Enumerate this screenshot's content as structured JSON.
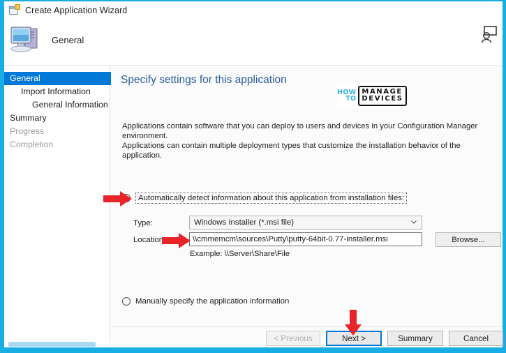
{
  "window": {
    "title": "Create Application Wizard",
    "icon": "wizard-app-icon"
  },
  "header": {
    "title": "General",
    "icon": "computer-icon",
    "right_icon": "user-account-icon"
  },
  "sidebar": {
    "items": [
      {
        "label": "General",
        "state": "selected",
        "indent": 0
      },
      {
        "label": "Import Information",
        "state": "normal",
        "indent": 1
      },
      {
        "label": "General Information",
        "state": "normal",
        "indent": 2
      },
      {
        "label": "Summary",
        "state": "normal",
        "indent": 0
      },
      {
        "label": "Progress",
        "state": "dim",
        "indent": 0
      },
      {
        "label": "Completion",
        "state": "dim",
        "indent": 0
      }
    ]
  },
  "main": {
    "page_title": "Specify settings for this application",
    "description_line1": "Applications contain software that you can deploy to users and devices in your Configuration Manager environment.",
    "description_line2": "Applications can contain multiple deployment types that customize the installation behavior of the application.",
    "watermark": {
      "how": "HOW",
      "to": "TO",
      "manage": "MANAGE",
      "devices": "DEVICES"
    },
    "radio_auto": {
      "label": "Automatically detect information about this application from installation files:",
      "selected": true
    },
    "radio_manual": {
      "label": "Manually specify the application information",
      "selected": false
    },
    "type": {
      "label": "Type:",
      "value": "Windows Installer (*.msi file)",
      "icon": "chevron-down-icon"
    },
    "location": {
      "label": "Location:",
      "value": "\\\\cmmemcm\\sources\\Putty\\putty-64bit-0.77-installer.msi",
      "example": "Example: \\\\Server\\Share\\File",
      "browse_label": "Browse..."
    }
  },
  "footer": {
    "previous_label": "< Previous",
    "next_label": "Next >",
    "summary_label": "Summary",
    "cancel_label": "Cancel"
  },
  "colors": {
    "frame": "#19aee3",
    "accent": "#0078d7",
    "title_text": "#2a5d9e",
    "annotation": "#e8232a"
  }
}
